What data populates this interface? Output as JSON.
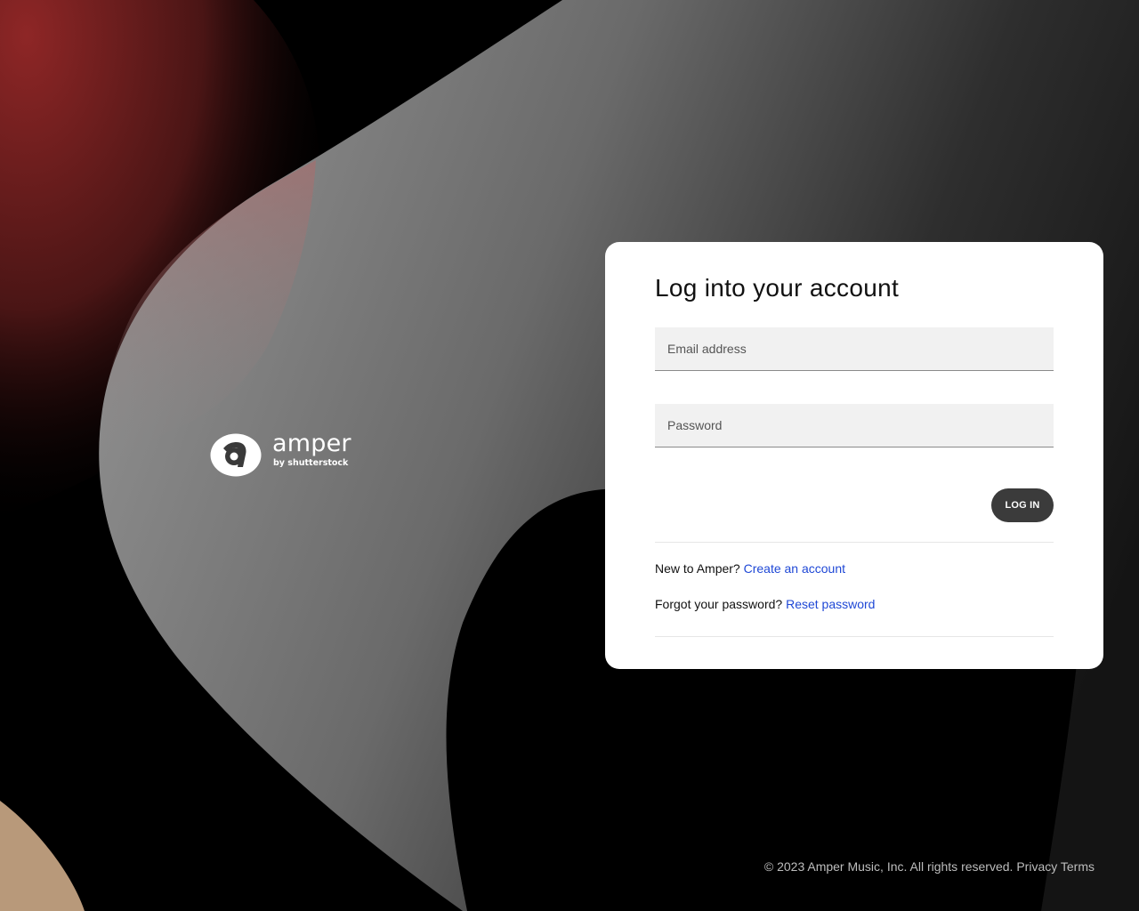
{
  "brand": {
    "name": "amper",
    "byline": "by shutterstock",
    "logo_icon": "amper-badge-icon"
  },
  "login": {
    "title": "Log into your account",
    "email_placeholder": "Email address",
    "password_placeholder": "Password",
    "submit_label": "LOG IN",
    "signup_prompt": "New to Amper?",
    "signup_link": "Create an account",
    "reset_prompt": "Forgot your password?",
    "reset_link": "Reset password"
  },
  "footer": {
    "copyright": "© 2023 Amper Music, Inc. All rights reserved.",
    "privacy_link": "Privacy",
    "terms_link": "Terms"
  },
  "colors": {
    "background": "#000000",
    "card": "#ffffff",
    "button": "#3b3b3b",
    "link": "#1f48d6",
    "accent_red": "#8a2424",
    "accent_tan": "#b89978"
  }
}
